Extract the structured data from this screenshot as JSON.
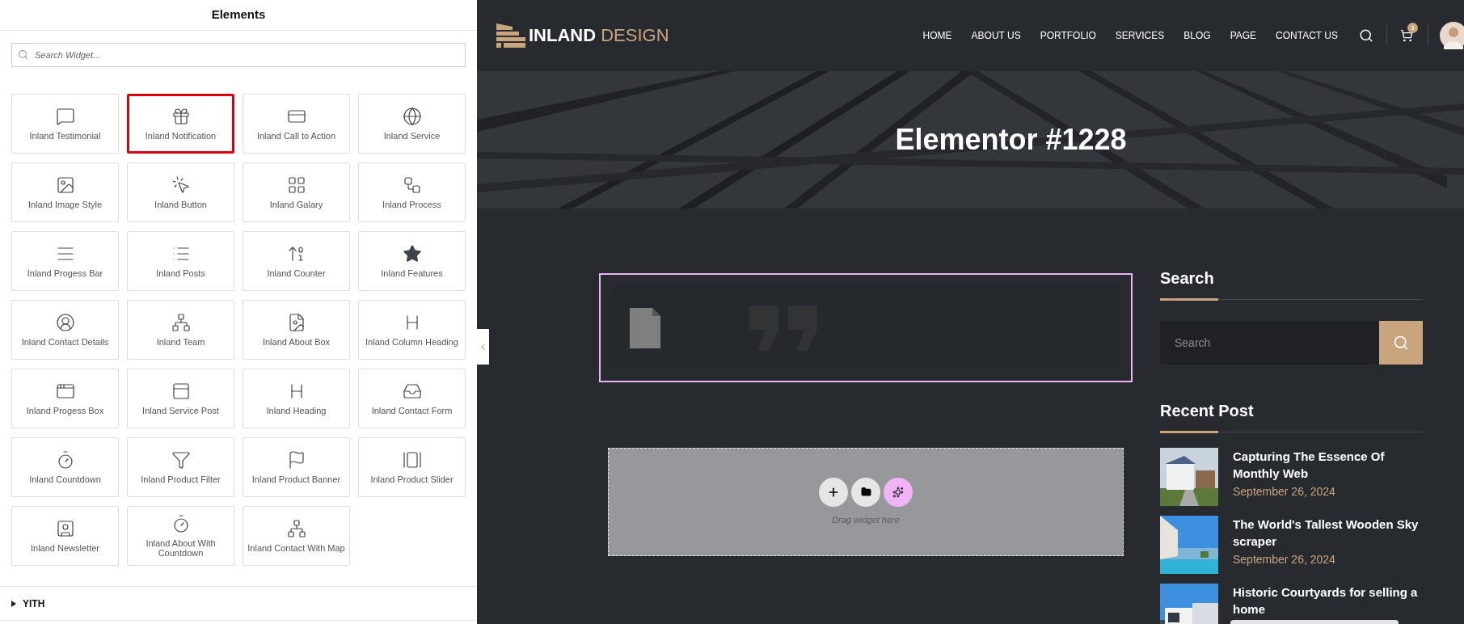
{
  "panel": {
    "title": "Elements",
    "search": {
      "placeholder": "Search Widget..."
    },
    "widgets": [
      {
        "label": "Inland Testimonial",
        "highlighted": false
      },
      {
        "label": "Inland Notification",
        "highlighted": true
      },
      {
        "label": "Inland Call to Action",
        "highlighted": false
      },
      {
        "label": "Inland Service",
        "highlighted": false
      },
      {
        "label": "Inland Image Style",
        "highlighted": false
      },
      {
        "label": "Inland Button",
        "highlighted": false
      },
      {
        "label": "Inland Galary",
        "highlighted": false
      },
      {
        "label": "Inland Process",
        "highlighted": false
      },
      {
        "label": "Inland Progess Bar",
        "highlighted": false
      },
      {
        "label": "Inland Posts",
        "highlighted": false
      },
      {
        "label": "Inland Counter",
        "highlighted": false
      },
      {
        "label": "Inland Features",
        "highlighted": false
      },
      {
        "label": "Inland Contact Details",
        "highlighted": false
      },
      {
        "label": "Inland Team",
        "highlighted": false
      },
      {
        "label": "Inland About Box",
        "highlighted": false
      },
      {
        "label": "Inland Column Heading",
        "highlighted": false
      },
      {
        "label": "Inland Progess Box",
        "highlighted": false
      },
      {
        "label": "Inland Service Post",
        "highlighted": false
      },
      {
        "label": "Inland Heading",
        "highlighted": false
      },
      {
        "label": "Inland Contact Form",
        "highlighted": false
      },
      {
        "label": "Inland Countdown",
        "highlighted": false
      },
      {
        "label": "Inland Product Filter",
        "highlighted": false
      },
      {
        "label": "Inland Product Banner",
        "highlighted": false
      },
      {
        "label": "Inland Product Slider",
        "highlighted": false
      },
      {
        "label": "Inland Newsletter",
        "highlighted": false
      },
      {
        "label": "Inland About With Countdown",
        "highlighted": false
      },
      {
        "label": "Inland Contact With Map",
        "highlighted": false
      }
    ],
    "categories": [
      {
        "label": "YITH",
        "expanded": false
      }
    ]
  },
  "site": {
    "logo": {
      "bold": "INLAND",
      "light": "DESIGN"
    },
    "nav": [
      {
        "label": "HOME"
      },
      {
        "label": "ABOUT US"
      },
      {
        "label": "PORTFOLIO"
      },
      {
        "label": "SERVICES"
      },
      {
        "label": "BLOG"
      },
      {
        "label": "PAGE"
      },
      {
        "label": "CONTACT US"
      }
    ],
    "cart_count": "3",
    "page_title": "Elementor #1228",
    "drop_zone": {
      "hint": "Drag widget here"
    },
    "sidebar": {
      "search_title": "Search",
      "search": {
        "placeholder": "Search"
      },
      "recent_title": "Recent Post",
      "posts": [
        {
          "title": "Capturing The Essence Of Monthly Web",
          "date": "September 26, 2024"
        },
        {
          "title": "The World's Tallest Wooden Sky scraper",
          "date": "September 26, 2024"
        },
        {
          "title": "Historic Courtyards for selling a home"
        }
      ]
    }
  }
}
